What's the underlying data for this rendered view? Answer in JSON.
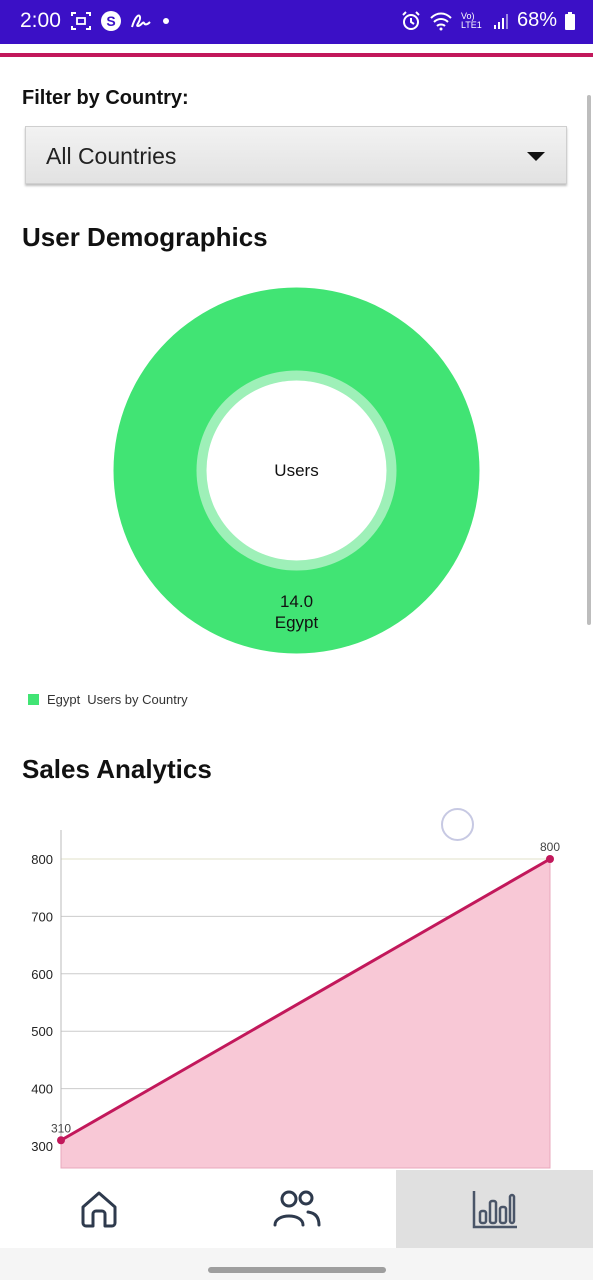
{
  "status_bar": {
    "time": "2:00",
    "battery": "68%",
    "network": "Vo) LTE1",
    "left_icons": [
      "screen-record-icon",
      "s-circle-icon",
      "signature-icon",
      "dot-icon"
    ],
    "right_icons": [
      "alarm-icon",
      "wifi-icon",
      "lte-icon",
      "signal-icon",
      "battery-icon"
    ],
    "background": "#3b10c6"
  },
  "filter": {
    "label": "Filter by Country:",
    "selected": "All Countries"
  },
  "demographics": {
    "title": "User Demographics",
    "center_label": "Users",
    "color": "#41e474",
    "legend": {
      "item": "Egypt",
      "series": "Users by Country"
    }
  },
  "sales": {
    "title": "Sales Analytics"
  },
  "chart_data": [
    {
      "type": "pie",
      "title": "Users",
      "series_name": "Users by Country",
      "categories": [
        "Egypt"
      ],
      "values": [
        14.0
      ],
      "value_label": "14.0",
      "colors": [
        "#41e474"
      ]
    },
    {
      "type": "area",
      "title": "",
      "x": [
        0,
        1
      ],
      "series": [
        {
          "name": "",
          "values": [
            310,
            800
          ]
        }
      ],
      "point_labels": [
        "310",
        "800"
      ],
      "yticks": [
        "300",
        "400",
        "500",
        "600",
        "700",
        "800"
      ],
      "ylim": [
        290,
        850
      ],
      "line_color": "#c2185b",
      "fill_color": "#f8c8d6",
      "grid": true
    }
  ],
  "bottom_nav": {
    "items": [
      {
        "name": "home",
        "icon": "home-icon",
        "active": false
      },
      {
        "name": "users",
        "icon": "users-icon",
        "active": false
      },
      {
        "name": "analytics",
        "icon": "bar-chart-icon",
        "active": true
      }
    ]
  }
}
